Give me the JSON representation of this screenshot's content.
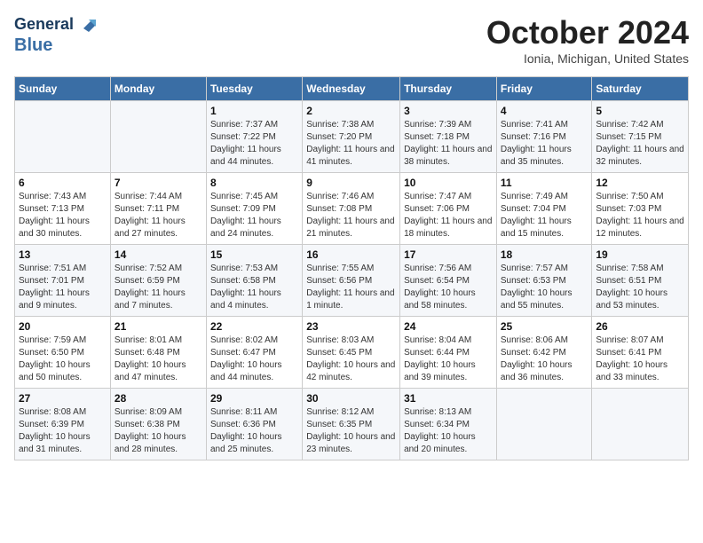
{
  "header": {
    "logo_line1": "General",
    "logo_line2": "Blue",
    "month": "October 2024",
    "location": "Ionia, Michigan, United States"
  },
  "weekdays": [
    "Sunday",
    "Monday",
    "Tuesday",
    "Wednesday",
    "Thursday",
    "Friday",
    "Saturday"
  ],
  "weeks": [
    [
      {
        "day": "",
        "sunrise": "",
        "sunset": "",
        "daylight": ""
      },
      {
        "day": "",
        "sunrise": "",
        "sunset": "",
        "daylight": ""
      },
      {
        "day": "1",
        "sunrise": "Sunrise: 7:37 AM",
        "sunset": "Sunset: 7:22 PM",
        "daylight": "Daylight: 11 hours and 44 minutes."
      },
      {
        "day": "2",
        "sunrise": "Sunrise: 7:38 AM",
        "sunset": "Sunset: 7:20 PM",
        "daylight": "Daylight: 11 hours and 41 minutes."
      },
      {
        "day": "3",
        "sunrise": "Sunrise: 7:39 AM",
        "sunset": "Sunset: 7:18 PM",
        "daylight": "Daylight: 11 hours and 38 minutes."
      },
      {
        "day": "4",
        "sunrise": "Sunrise: 7:41 AM",
        "sunset": "Sunset: 7:16 PM",
        "daylight": "Daylight: 11 hours and 35 minutes."
      },
      {
        "day": "5",
        "sunrise": "Sunrise: 7:42 AM",
        "sunset": "Sunset: 7:15 PM",
        "daylight": "Daylight: 11 hours and 32 minutes."
      }
    ],
    [
      {
        "day": "6",
        "sunrise": "Sunrise: 7:43 AM",
        "sunset": "Sunset: 7:13 PM",
        "daylight": "Daylight: 11 hours and 30 minutes."
      },
      {
        "day": "7",
        "sunrise": "Sunrise: 7:44 AM",
        "sunset": "Sunset: 7:11 PM",
        "daylight": "Daylight: 11 hours and 27 minutes."
      },
      {
        "day": "8",
        "sunrise": "Sunrise: 7:45 AM",
        "sunset": "Sunset: 7:09 PM",
        "daylight": "Daylight: 11 hours and 24 minutes."
      },
      {
        "day": "9",
        "sunrise": "Sunrise: 7:46 AM",
        "sunset": "Sunset: 7:08 PM",
        "daylight": "Daylight: 11 hours and 21 minutes."
      },
      {
        "day": "10",
        "sunrise": "Sunrise: 7:47 AM",
        "sunset": "Sunset: 7:06 PM",
        "daylight": "Daylight: 11 hours and 18 minutes."
      },
      {
        "day": "11",
        "sunrise": "Sunrise: 7:49 AM",
        "sunset": "Sunset: 7:04 PM",
        "daylight": "Daylight: 11 hours and 15 minutes."
      },
      {
        "day": "12",
        "sunrise": "Sunrise: 7:50 AM",
        "sunset": "Sunset: 7:03 PM",
        "daylight": "Daylight: 11 hours and 12 minutes."
      }
    ],
    [
      {
        "day": "13",
        "sunrise": "Sunrise: 7:51 AM",
        "sunset": "Sunset: 7:01 PM",
        "daylight": "Daylight: 11 hours and 9 minutes."
      },
      {
        "day": "14",
        "sunrise": "Sunrise: 7:52 AM",
        "sunset": "Sunset: 6:59 PM",
        "daylight": "Daylight: 11 hours and 7 minutes."
      },
      {
        "day": "15",
        "sunrise": "Sunrise: 7:53 AM",
        "sunset": "Sunset: 6:58 PM",
        "daylight": "Daylight: 11 hours and 4 minutes."
      },
      {
        "day": "16",
        "sunrise": "Sunrise: 7:55 AM",
        "sunset": "Sunset: 6:56 PM",
        "daylight": "Daylight: 11 hours and 1 minute."
      },
      {
        "day": "17",
        "sunrise": "Sunrise: 7:56 AM",
        "sunset": "Sunset: 6:54 PM",
        "daylight": "Daylight: 10 hours and 58 minutes."
      },
      {
        "day": "18",
        "sunrise": "Sunrise: 7:57 AM",
        "sunset": "Sunset: 6:53 PM",
        "daylight": "Daylight: 10 hours and 55 minutes."
      },
      {
        "day": "19",
        "sunrise": "Sunrise: 7:58 AM",
        "sunset": "Sunset: 6:51 PM",
        "daylight": "Daylight: 10 hours and 53 minutes."
      }
    ],
    [
      {
        "day": "20",
        "sunrise": "Sunrise: 7:59 AM",
        "sunset": "Sunset: 6:50 PM",
        "daylight": "Daylight: 10 hours and 50 minutes."
      },
      {
        "day": "21",
        "sunrise": "Sunrise: 8:01 AM",
        "sunset": "Sunset: 6:48 PM",
        "daylight": "Daylight: 10 hours and 47 minutes."
      },
      {
        "day": "22",
        "sunrise": "Sunrise: 8:02 AM",
        "sunset": "Sunset: 6:47 PM",
        "daylight": "Daylight: 10 hours and 44 minutes."
      },
      {
        "day": "23",
        "sunrise": "Sunrise: 8:03 AM",
        "sunset": "Sunset: 6:45 PM",
        "daylight": "Daylight: 10 hours and 42 minutes."
      },
      {
        "day": "24",
        "sunrise": "Sunrise: 8:04 AM",
        "sunset": "Sunset: 6:44 PM",
        "daylight": "Daylight: 10 hours and 39 minutes."
      },
      {
        "day": "25",
        "sunrise": "Sunrise: 8:06 AM",
        "sunset": "Sunset: 6:42 PM",
        "daylight": "Daylight: 10 hours and 36 minutes."
      },
      {
        "day": "26",
        "sunrise": "Sunrise: 8:07 AM",
        "sunset": "Sunset: 6:41 PM",
        "daylight": "Daylight: 10 hours and 33 minutes."
      }
    ],
    [
      {
        "day": "27",
        "sunrise": "Sunrise: 8:08 AM",
        "sunset": "Sunset: 6:39 PM",
        "daylight": "Daylight: 10 hours and 31 minutes."
      },
      {
        "day": "28",
        "sunrise": "Sunrise: 8:09 AM",
        "sunset": "Sunset: 6:38 PM",
        "daylight": "Daylight: 10 hours and 28 minutes."
      },
      {
        "day": "29",
        "sunrise": "Sunrise: 8:11 AM",
        "sunset": "Sunset: 6:36 PM",
        "daylight": "Daylight: 10 hours and 25 minutes."
      },
      {
        "day": "30",
        "sunrise": "Sunrise: 8:12 AM",
        "sunset": "Sunset: 6:35 PM",
        "daylight": "Daylight: 10 hours and 23 minutes."
      },
      {
        "day": "31",
        "sunrise": "Sunrise: 8:13 AM",
        "sunset": "Sunset: 6:34 PM",
        "daylight": "Daylight: 10 hours and 20 minutes."
      },
      {
        "day": "",
        "sunrise": "",
        "sunset": "",
        "daylight": ""
      },
      {
        "day": "",
        "sunrise": "",
        "sunset": "",
        "daylight": ""
      }
    ]
  ]
}
